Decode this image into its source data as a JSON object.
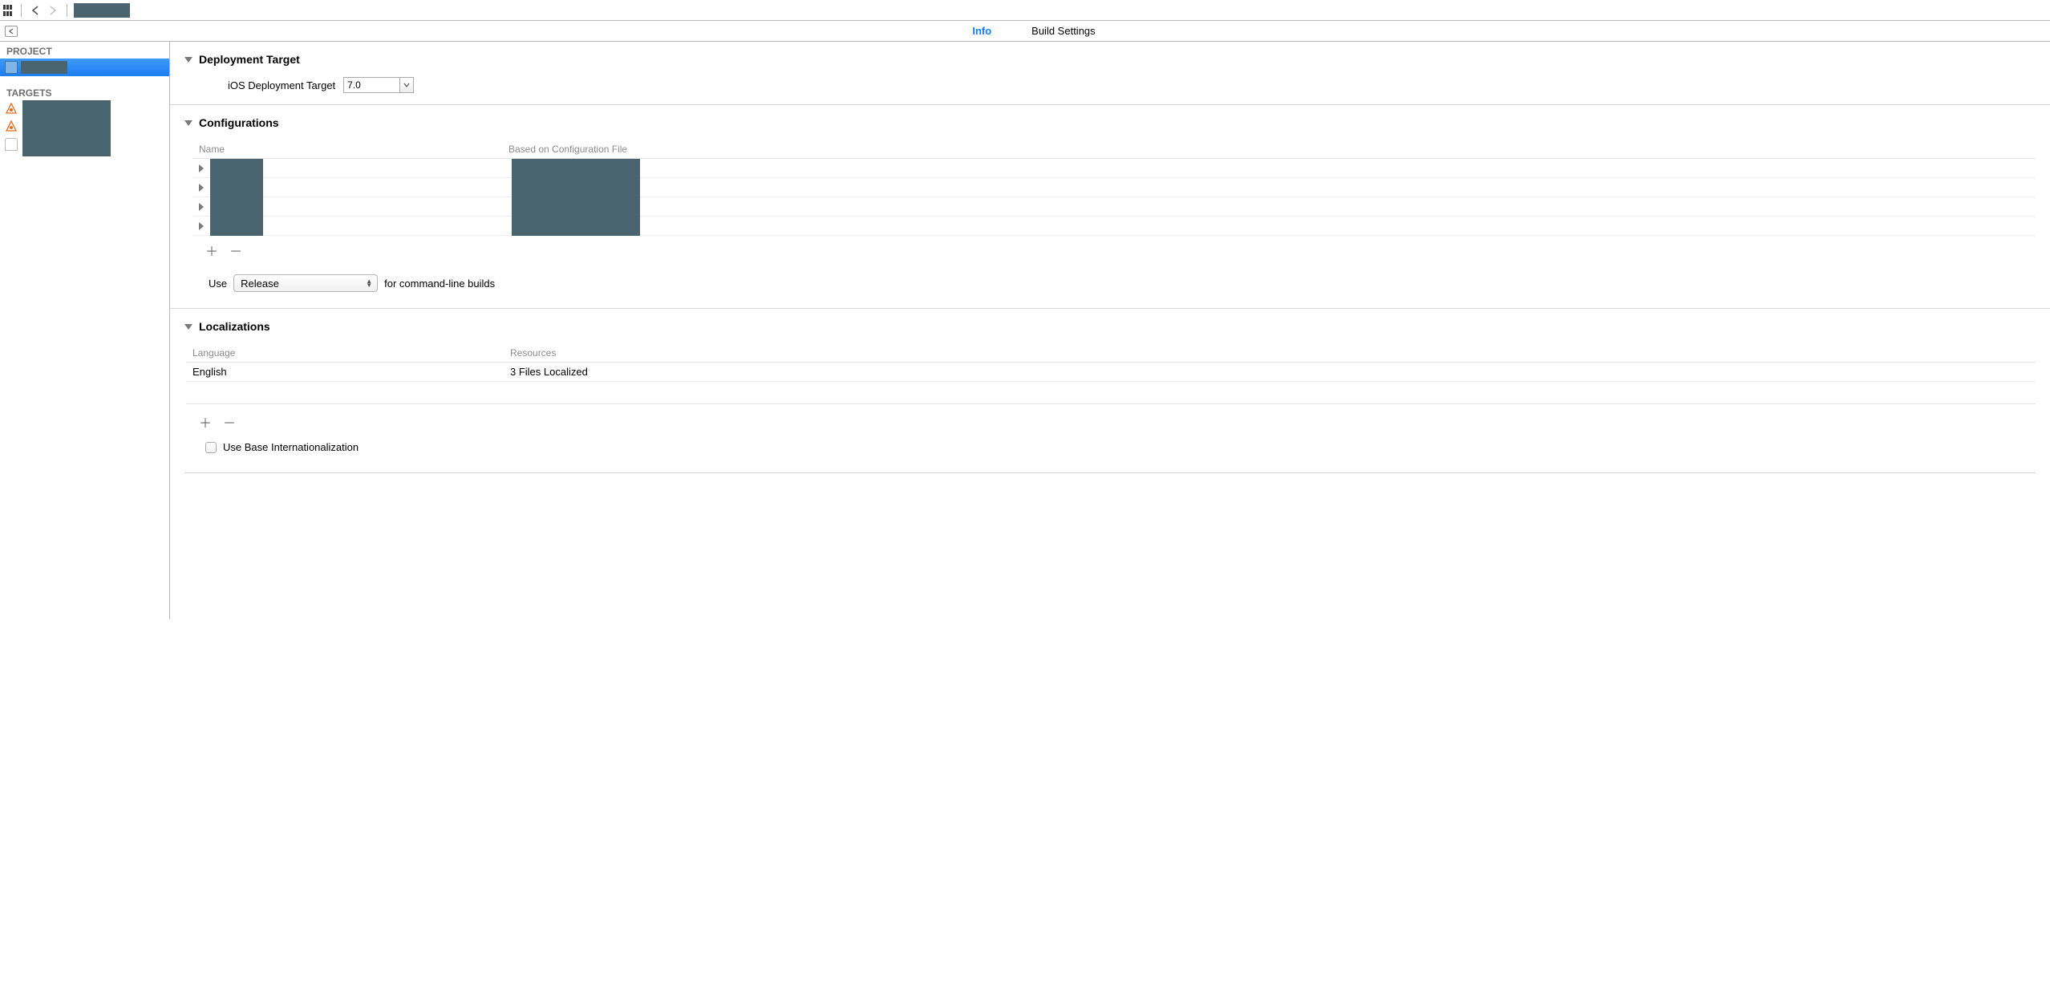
{
  "tabs": {
    "info": "Info",
    "build_settings": "Build Settings"
  },
  "sidebar": {
    "project_header": "PROJECT",
    "targets_header": "TARGETS"
  },
  "deployment": {
    "section_title": "Deployment Target",
    "label": "iOS Deployment Target",
    "value": "7.0"
  },
  "configurations": {
    "section_title": "Configurations",
    "col_name": "Name",
    "col_file": "Based on Configuration File",
    "use_label": "Use",
    "use_value": "Release",
    "use_suffix": "for command-line builds"
  },
  "localizations": {
    "section_title": "Localizations",
    "col_lang": "Language",
    "col_res": "Resources",
    "rows": [
      {
        "language": "English",
        "resources": "3 Files Localized"
      }
    ],
    "use_base_label": "Use Base Internationalization"
  }
}
